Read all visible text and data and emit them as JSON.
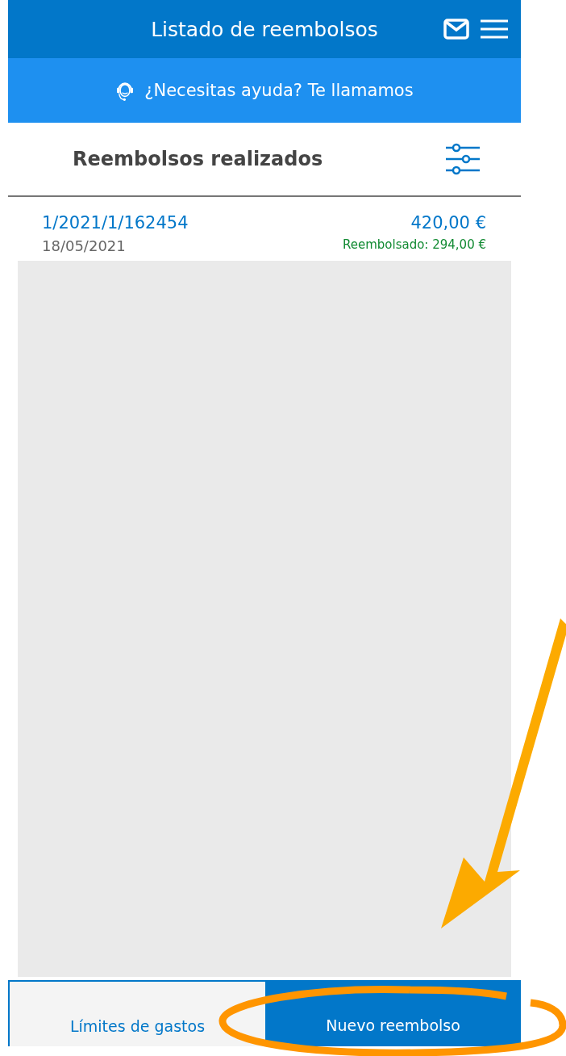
{
  "header": {
    "title": "Listado de reembolsos"
  },
  "help_bar": {
    "label": "¿Necesitas ayuda? Te llamamos"
  },
  "section": {
    "title": "Reembolsos realizados"
  },
  "refunds": [
    {
      "number": "1/2021/1/162454",
      "date": "18/05/2021",
      "amount": "420,00 €",
      "refunded": "Reembolsado: 294,00 €"
    }
  ],
  "buttons": [
    {
      "label": "Límites de gastos",
      "kind": "secondary"
    },
    {
      "label": "Nuevo reembolso",
      "kind": "primary"
    }
  ]
}
